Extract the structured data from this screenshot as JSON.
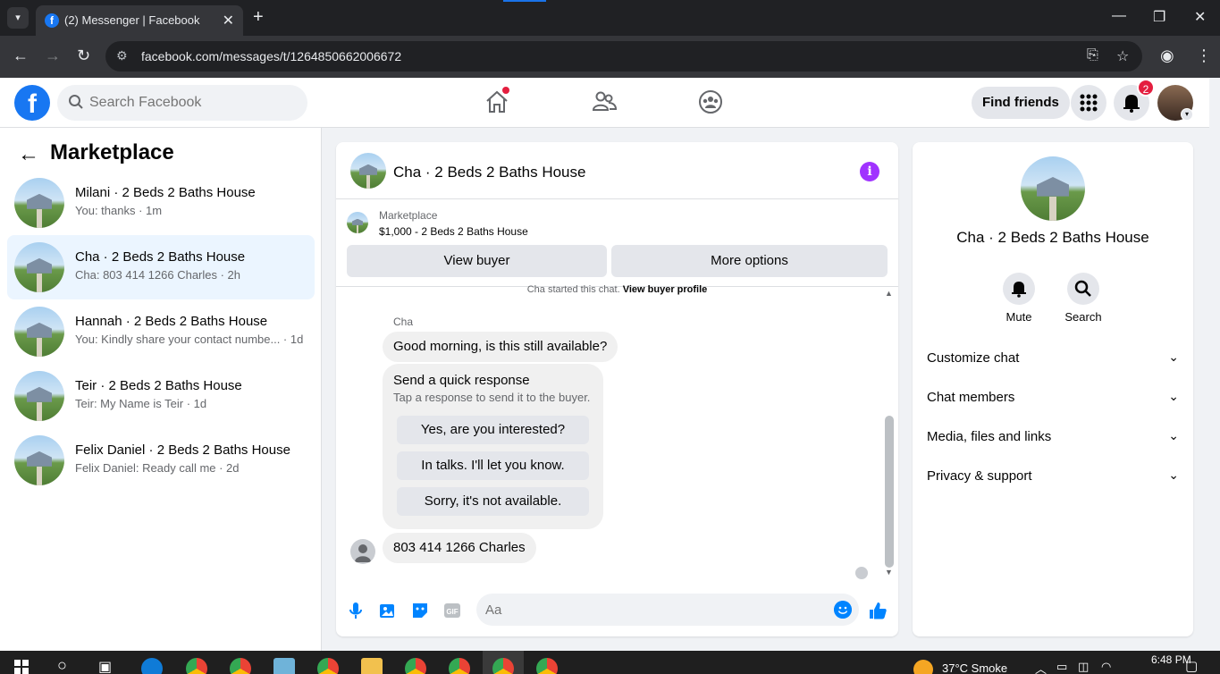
{
  "browser": {
    "tab_title": "(2) Messenger | Facebook",
    "url": "facebook.com/messages/t/1264850662006672"
  },
  "header": {
    "search_placeholder": "Search Facebook",
    "find_friends": "Find friends",
    "notification_count": "2"
  },
  "sidebar": {
    "title": "Marketplace",
    "conversations": [
      {
        "name": "Milani · 2 Beds 2 Baths House",
        "preview": "You: thanks · 1m",
        "active": false
      },
      {
        "name": "Cha · 2 Beds 2 Baths House",
        "preview": "Cha: 803 414 1266 Charles · 2h",
        "active": true
      },
      {
        "name": "Hannah · 2 Beds 2 Baths House",
        "preview": "You: Kindly share your contact numbe... · 1d",
        "active": false
      },
      {
        "name": "Teir · 2 Beds 2 Baths House",
        "preview": "Teir: My Name is Teir · 1d",
        "active": false
      },
      {
        "name": "Felix Daniel · 2 Beds 2 Baths House",
        "preview": "Felix Daniel: Ready call me · 2d",
        "active": false
      }
    ]
  },
  "chat": {
    "title": "Cha · 2 Beds 2 Baths House",
    "marketplace_label": "Marketplace",
    "listing": "$1,000 - 2 Beds 2 Baths House",
    "view_buyer": "View buyer",
    "more_options": "More options",
    "started_text": "Cha started this chat.",
    "view_buyer_profile": "View buyer profile",
    "sender": "Cha",
    "message_1": "Good morning, is this still available?",
    "quick_response_title": "Send a quick response",
    "quick_response_sub": "Tap a response to send it to the buyer.",
    "quick_responses": [
      "Yes, are you interested?",
      "In talks. I'll let you know.",
      "Sorry, it's not available."
    ],
    "message_2": "803 414 1266 Charles",
    "composer_placeholder": "Aa"
  },
  "details": {
    "name": "Cha · 2 Beds 2 Baths House",
    "mute": "Mute",
    "search": "Search",
    "sections": [
      "Customize chat",
      "Chat members",
      "Media, files and links",
      "Privacy & support"
    ]
  },
  "taskbar": {
    "weather": "37°C  Smoke",
    "time": "6:48 PM"
  },
  "colors": {
    "brand": "#1877f2",
    "accent": "#0084ff",
    "info": "#a033ff",
    "badge": "#e41e3f"
  }
}
